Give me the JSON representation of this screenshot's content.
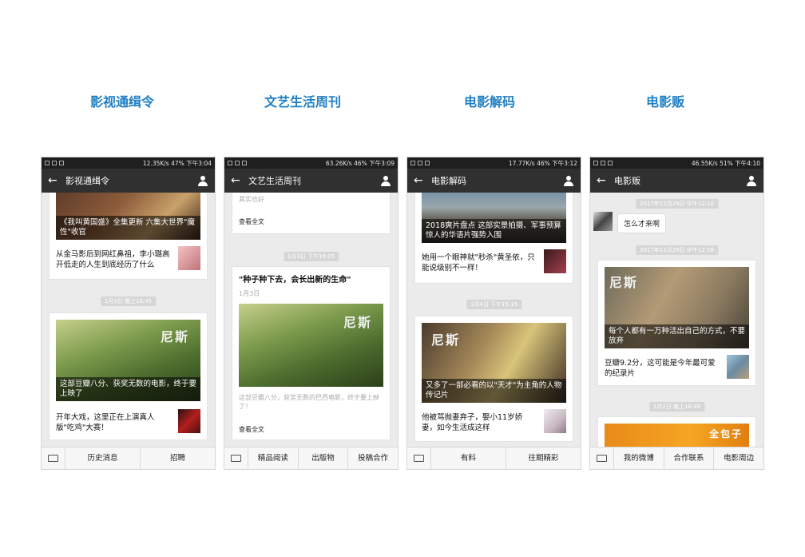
{
  "column_titles": [
    "影视通缉令",
    "文艺生活周刊",
    "电影解码",
    "电影贩"
  ],
  "phones": [
    {
      "status_left": "",
      "status_right": "12.35K/s 47% 下午3:04",
      "nav_title": "影视通缉令",
      "cards": {
        "c1_caption": "《我叫黄国盛》全集更新 六集大世界\"魔性\"收官",
        "c1_sub": "从金马影后到网红鼻祖，李小璐高开低走的人生到底经历了什么",
        "time1": "1月3日 晚上18:45",
        "c2_caption": "这部豆瓣八分、获奖无数的电影，终于要上映了",
        "c2_logo": "尼斯",
        "c2_sub": "开年大戏，这里正在上演真人版\"吃鸡\"大赛！"
      },
      "tabs": [
        "历史消息",
        "招聘"
      ]
    },
    {
      "status_right": "63.26K/s 46% 下午3:09",
      "nav_title": "文艺生活周刊",
      "cards": {
        "top_small_1": "其实也好",
        "read_all_1": "查看全文",
        "time1": "1月3日 下午19:05",
        "title": "\"种子种下去，会长出新的生命\"",
        "date": "1月3日",
        "logo": "尼斯",
        "desc": "这部豆瓣八分，获奖无数的巴西电影，终于要上映了！",
        "read_all_2": "查看全文"
      },
      "tabs": [
        "精品阅读",
        "出版物",
        "投稿合作"
      ]
    },
    {
      "status_right": "17.77K/s 46% 下午3:12",
      "nav_title": "电影解码",
      "cards": {
        "c1_caption": "2018爽片盘点 这部实景拍摄、军事预算惊人的华语片强势入围",
        "c1_sub": "她用一个眼神就\"秒杀\"黄圣依，只能说级别不一样！",
        "time1": "1月4日 下午15:15",
        "c2_caption": "又多了一部必看的以\"天才\"为主角的人物传记片",
        "c2_logo": "尼斯",
        "c2_sub": "他被骂抛妻弃子，娶小11岁娇妻，如今生活成这样"
      },
      "tabs": [
        "有料",
        "往期精彩"
      ]
    },
    {
      "status_right": "46.55K/s 51% 下午4:10",
      "nav_title": "电影贩",
      "cards": {
        "time0": "2017年12月29日 中午12:10",
        "bubble": "怎么才来啊",
        "time1": "2017年12月29日 中午12:58",
        "c1_logo": "尼斯",
        "c1_caption": "每个人都有一万种活出自己的方式，不要放弃",
        "c1_sub": "豆瓣9.2分，这可能是今年最可爱的纪录片",
        "time2": "1月2日 晚上18:48",
        "c2_logo": "全包子"
      },
      "tabs": [
        "我的微博",
        "合作联系",
        "电影周边"
      ]
    }
  ]
}
